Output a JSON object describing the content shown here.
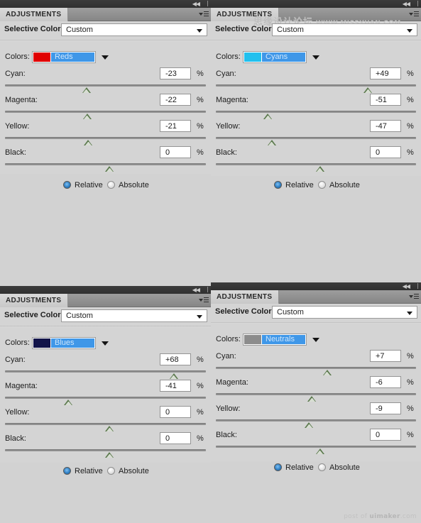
{
  "panel_common": {
    "tab_label": "ADJUSTMENTS",
    "title": "Selective Color",
    "preset_value": "Custom",
    "colors_label": "Colors:",
    "percent_symbol": "%",
    "method_relative": "Relative",
    "method_absolute": "Absolute",
    "slider_names": {
      "cyan": "Cyan:",
      "magenta": "Magenta:",
      "yellow": "Yellow:",
      "black": "Black:"
    },
    "icons": {
      "collapse": "collapse-arrows-icon",
      "panel_menu": "panel-menu-icon",
      "dropdown_chevron": "chevron-down-icon"
    }
  },
  "watermark": {
    "cn_text": "思缘设计论坛",
    "url_text": "WWW.MISSYUAN.COM"
  },
  "footer": {
    "prefix": "post of ",
    "brand": "uimaker",
    "suffix": ".com"
  },
  "panels": [
    {
      "id": "panel-reds",
      "color_name": "Reds",
      "swatch_color": "#e00000",
      "sliders": [
        {
          "key": "cyan",
          "value": "-23",
          "pos": 40.5
        },
        {
          "key": "magenta",
          "value": "-22",
          "pos": 40.9
        },
        {
          "key": "yellow",
          "value": "-21",
          "pos": 41.4
        },
        {
          "key": "black",
          "value": "0",
          "pos": 52.0
        }
      ],
      "method": "Relative"
    },
    {
      "id": "panel-cyans",
      "color_name": "Cyans",
      "swatch_color": "#22c0ee",
      "sliders": [
        {
          "key": "cyan",
          "value": "+49",
          "pos": 76.0
        },
        {
          "key": "magenta",
          "value": "-51",
          "pos": 26.0
        },
        {
          "key": "yellow",
          "value": "-47",
          "pos": 28.0
        },
        {
          "key": "black",
          "value": "0",
          "pos": 52.0
        }
      ],
      "method": "Relative"
    },
    {
      "id": "panel-blues",
      "color_name": "Blues",
      "swatch_color": "#121449",
      "sliders": [
        {
          "key": "cyan",
          "value": "+68",
          "pos": 84.0
        },
        {
          "key": "magenta",
          "value": "-41",
          "pos": 31.5
        },
        {
          "key": "yellow",
          "value": "0",
          "pos": 52.0
        },
        {
          "key": "black",
          "value": "0",
          "pos": 52.0
        }
      ],
      "method": "Relative"
    },
    {
      "id": "panel-neutrals",
      "color_name": "Neutrals",
      "swatch_color": "#8c8c8c",
      "sliders": [
        {
          "key": "cyan",
          "value": "+7",
          "pos": 55.5
        },
        {
          "key": "magenta",
          "value": "-6",
          "pos": 48.0
        },
        {
          "key": "yellow",
          "value": "-9",
          "pos": 46.5
        },
        {
          "key": "black",
          "value": "0",
          "pos": 52.0
        }
      ],
      "method": "Relative"
    }
  ]
}
